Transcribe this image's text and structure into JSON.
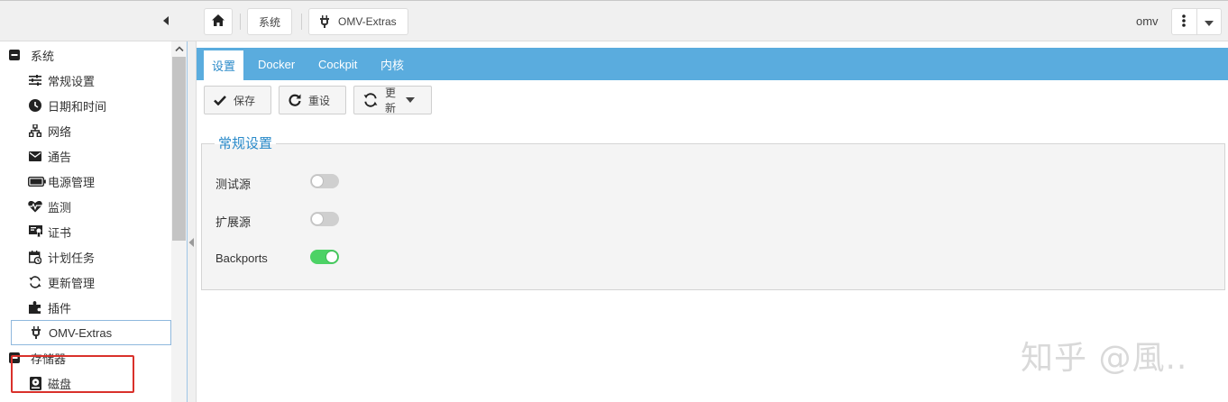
{
  "topbar": {
    "breadcrumbs": [
      "系统",
      "OMV-Extras"
    ],
    "user": "omv"
  },
  "sidebar": {
    "groups": [
      {
        "label": "系统",
        "items": [
          {
            "label": "常规设置",
            "icon": "sliders-icon"
          },
          {
            "label": "日期和时间",
            "icon": "clock-icon"
          },
          {
            "label": "网络",
            "icon": "network-icon"
          },
          {
            "label": "通告",
            "icon": "envelope-icon"
          },
          {
            "label": "电源管理",
            "icon": "battery-icon"
          },
          {
            "label": "监测",
            "icon": "heartbeat-icon"
          },
          {
            "label": "证书",
            "icon": "certificate-icon"
          },
          {
            "label": "计划任务",
            "icon": "calendar-clock-icon"
          },
          {
            "label": "更新管理",
            "icon": "refresh-icon"
          },
          {
            "label": "插件",
            "icon": "puzzle-icon"
          },
          {
            "label": "OMV-Extras",
            "icon": "plug-icon",
            "selected": true
          }
        ]
      },
      {
        "label": "存储器",
        "items": [
          {
            "label": "磁盘",
            "icon": "disk-icon"
          }
        ]
      }
    ]
  },
  "tabs": [
    {
      "label": "设置",
      "active": true
    },
    {
      "label": "Docker"
    },
    {
      "label": "Cockpit"
    },
    {
      "label": "内核"
    }
  ],
  "toolbar": {
    "save_label": "保存",
    "reset_label": "重设",
    "update_label": "更新"
  },
  "form": {
    "legend": "常规设置",
    "fields": [
      {
        "label": "测试源",
        "checked": false
      },
      {
        "label": "扩展源",
        "checked": false
      },
      {
        "label": "Backports",
        "checked": true
      }
    ]
  },
  "watermark": "知乎 @風..",
  "colors": {
    "accent": "#5aacde",
    "toggle_on": "#4cd265",
    "highlight": "#d9312b"
  }
}
